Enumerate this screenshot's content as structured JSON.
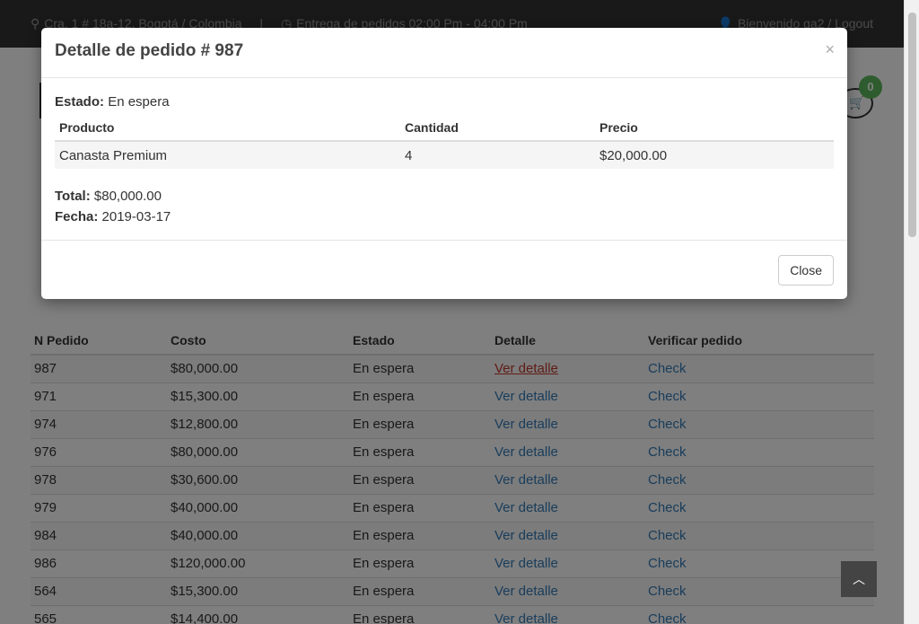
{
  "topbar": {
    "address": "Cra. 1 # 18a-12, Bogotá / Colombia",
    "separator": "|",
    "delivery": "Entrega de pedidos 02:00 Pm - 04:00 Pm",
    "welcome": "Bienvenido ga2",
    "slash": "/",
    "logout": "Logout"
  },
  "cart": {
    "count": "0"
  },
  "orders": {
    "headers": [
      "N Pedido",
      "Costo",
      "Estado",
      "Detalle",
      "Verificar pedido"
    ],
    "rows": [
      {
        "id": "987",
        "cost": "$80,000.00",
        "status": "En espera",
        "detail": "Ver detalle",
        "check": "Check"
      },
      {
        "id": "971",
        "cost": "$15,300.00",
        "status": "En espera",
        "detail": "Ver detalle",
        "check": "Check"
      },
      {
        "id": "974",
        "cost": "$12,800.00",
        "status": "En espera",
        "detail": "Ver detalle",
        "check": "Check"
      },
      {
        "id": "976",
        "cost": "$80,000.00",
        "status": "En espera",
        "detail": "Ver detalle",
        "check": "Check"
      },
      {
        "id": "978",
        "cost": "$30,600.00",
        "status": "En espera",
        "detail": "Ver detalle",
        "check": "Check"
      },
      {
        "id": "979",
        "cost": "$40,000.00",
        "status": "En espera",
        "detail": "Ver detalle",
        "check": "Check"
      },
      {
        "id": "984",
        "cost": "$40,000.00",
        "status": "En espera",
        "detail": "Ver detalle",
        "check": "Check"
      },
      {
        "id": "986",
        "cost": "$120,000.00",
        "status": "En espera",
        "detail": "Ver detalle",
        "check": "Check"
      },
      {
        "id": "564",
        "cost": "$15,300.00",
        "status": "En espera",
        "detail": "Ver detalle",
        "check": "Check"
      },
      {
        "id": "565",
        "cost": "$14,400.00",
        "status": "En espera",
        "detail": "Ver detalle",
        "check": "Check"
      }
    ]
  },
  "modal": {
    "title": "Detalle de pedido # 987",
    "close_x": "×",
    "estado_label": "Estado:",
    "estado_value": "En espera",
    "headers": [
      "Producto",
      "Cantidad",
      "Precio"
    ],
    "items": [
      {
        "product": "Canasta Premium",
        "qty": "4",
        "price": "$20,000.00"
      }
    ],
    "total_label": "Total:",
    "total_value": "$80,000.00",
    "fecha_label": "Fecha:",
    "fecha_value": "2019-03-17",
    "close_button": "Close"
  },
  "icons": {
    "location": "map-marker-icon",
    "clock": "clock-icon",
    "user": "user-icon",
    "cart": "shopping-cart-icon",
    "to_top": "chevron-up-icon"
  },
  "colors": {
    "topbar": "#333333",
    "link": "#337ab7",
    "active_link": "#c0392b",
    "badge": "#5cb85c"
  }
}
